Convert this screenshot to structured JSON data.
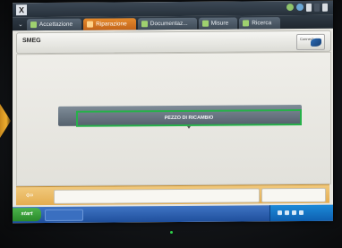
{
  "tabs": [
    {
      "label": "Accettazione",
      "icon": "car-icon",
      "active": false
    },
    {
      "label": "Riparazione",
      "icon": "wrench-icon",
      "active": true
    },
    {
      "label": "Documentaz...",
      "icon": "document-icon",
      "active": false
    },
    {
      "label": "Misure",
      "icon": "gauge-icon",
      "active": false
    },
    {
      "label": "Ricerca",
      "icon": "search-icon",
      "active": false
    }
  ],
  "header": {
    "brand": "SMEG",
    "connect_label": "Connect"
  },
  "main": {
    "part_button_label": "PEZZO DI RICAMBIO"
  },
  "taskbar": {
    "start_label": "start"
  },
  "colors": {
    "accent_tab": "#d9782a",
    "highlight": "#27b04a",
    "bottom_panel": "#e9b860"
  }
}
